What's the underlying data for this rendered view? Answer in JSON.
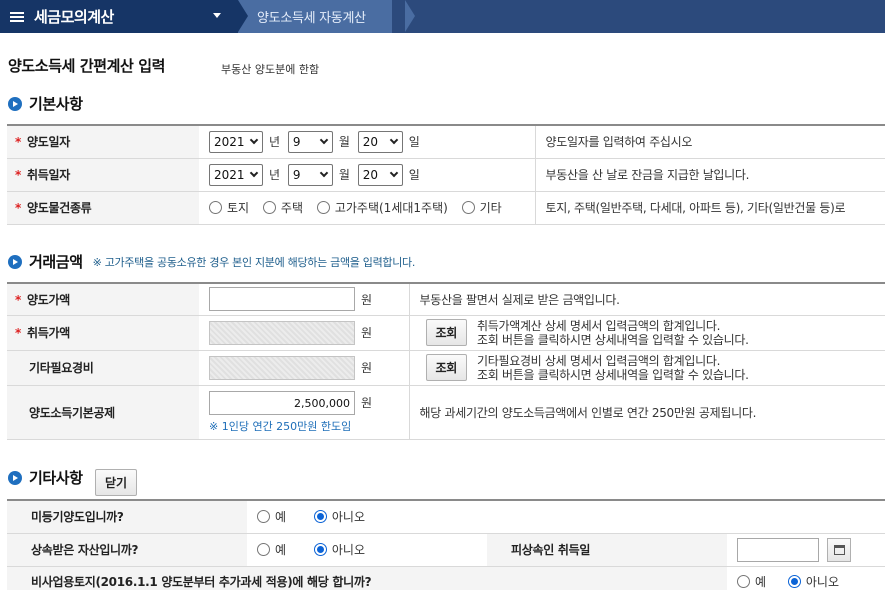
{
  "nav": {
    "menu_title": "세금모의계산",
    "breadcrumb": "양도소득세 자동계산"
  },
  "page": {
    "title": "양도소득세 간편계산 입력",
    "subtitle": "부동산 양도분에 한함"
  },
  "basic": {
    "section_title": "기본사항",
    "transfer_date": {
      "label": "양도일자",
      "year": "2021",
      "year_unit": "년",
      "month": "9",
      "month_unit": "월",
      "day": "20",
      "day_unit": "일",
      "desc": "양도일자를 입력하여 주십시오"
    },
    "acquire_date": {
      "label": "취득일자",
      "year": "2021",
      "year_unit": "년",
      "month": "9",
      "month_unit": "월",
      "day": "20",
      "day_unit": "일",
      "desc": "부동산을 산 날로 잔금을 지급한 날입니다."
    },
    "property_type": {
      "label": "양도물건종류",
      "options": [
        "토지",
        "주택",
        "고가주택(1세대1주택)",
        "기타"
      ],
      "desc": "토지, 주택(일반주택, 다세대, 아파트 등), 기타(일반건물 등)로"
    }
  },
  "amount": {
    "section_title": "거래금액",
    "note": "※ 고가주택을 공동소유한 경우 본인 지분에 해당하는 금액을 입력합니다.",
    "won": "원",
    "transfer_price": {
      "label": "양도가액",
      "value": "",
      "desc": "부동산을 팔면서 실제로 받은 금액입니다."
    },
    "acquire_price": {
      "label": "취득가액",
      "value": "",
      "button": "조회",
      "desc1": "취득가액계산 상세 명세서 입력금액의 합계입니다.",
      "desc2": "조회 버튼을 클릭하시면 상세내역을 입력할 수 있습니다."
    },
    "other_expense": {
      "label": "기타필요경비",
      "value": "",
      "button": "조회",
      "desc1": "기타필요경비 상세 명세서 입력금액의 합계입니다.",
      "desc2": "조회 버튼을 클릭하시면 상세내역을 입력할 수 있습니다."
    },
    "basic_deduction": {
      "label": "양도소득기본공제",
      "value": "2,500,000",
      "hint": "※ 1인당 연간 250만원 한도임",
      "desc": "해당 과세기간의 양도소득금액에서 인별로 연간 250만원 공제됩니다."
    }
  },
  "other": {
    "section_title": "기타사항",
    "close_button": "닫기",
    "yes": "예",
    "no": "아니오",
    "unregistered": {
      "label": "미등기양도입니까?",
      "selected": "아니오"
    },
    "inherited": {
      "label": "상속받은 자산입니까?",
      "selected": "아니오",
      "acq_label": "피상속인 취득일",
      "acq_value": ""
    },
    "non_business_land": {
      "label": "비사업용토지(2016.1.1 양도분부터 추가과세 적용)에 해당 합니까?",
      "selected": "아니오"
    }
  }
}
